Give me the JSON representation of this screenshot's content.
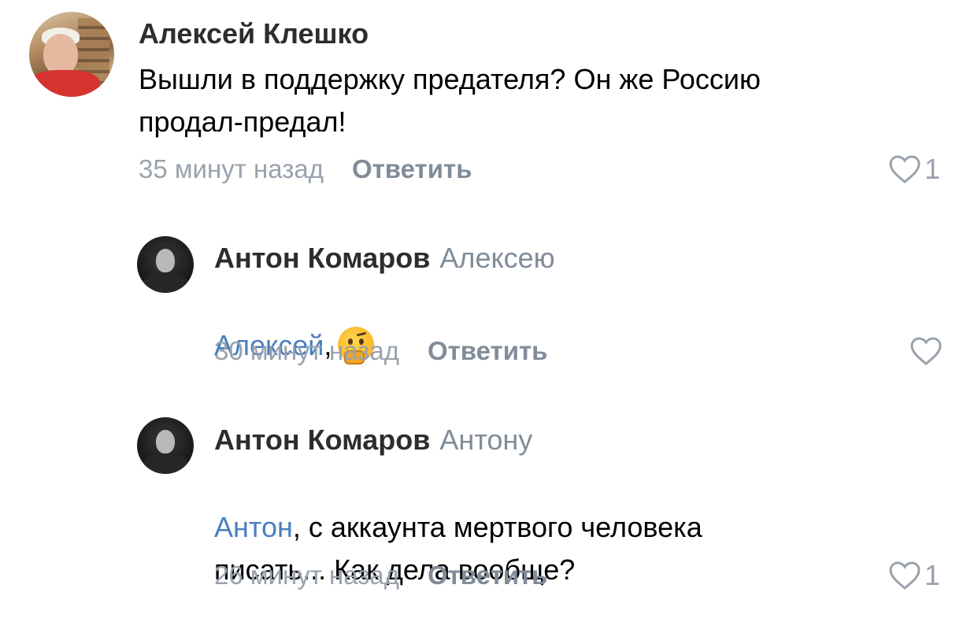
{
  "comments": [
    {
      "author": "Алексей Клешко",
      "text": "Вышли в поддержку предателя? Он же Россию\nпродал-предал!",
      "time": "35 минут назад",
      "reply_label": "Ответить",
      "likes": "1"
    }
  ],
  "replies": [
    {
      "author": "Антон Комаров",
      "addressee": "Алексею",
      "mention": "Алексей",
      "text_after_mention": ",",
      "emoji": "thinking-face",
      "time": "30 минут назад",
      "reply_label": "Ответить"
    },
    {
      "author": "Антон Комаров",
      "addressee": "Антону",
      "mention": "Антон",
      "text_after_mention": ", с аккаунта мертвого человека\nписать... Как дела вообще?",
      "time": "26 минут назад",
      "reply_label": "Ответить",
      "likes": "1"
    }
  ],
  "colors": {
    "author": "#2c2d2e",
    "meta": "#99a2ad",
    "mention": "#4a7fbf",
    "secondary": "#818c99"
  },
  "icons": {
    "like": "heart-outline-icon"
  }
}
